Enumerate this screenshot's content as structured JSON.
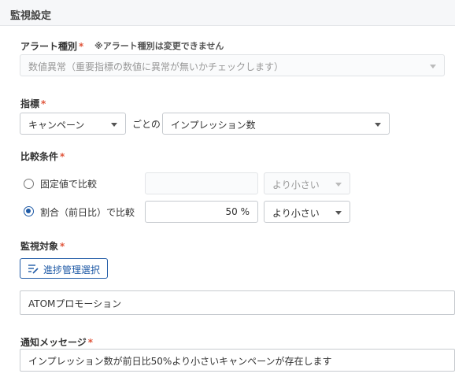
{
  "header": {
    "title": "監視設定"
  },
  "alert_type": {
    "label": "アラート種別",
    "required_mark": "*",
    "note": "※アラート種別は変更できません",
    "value": "数値異常（重要指標の数値に異常が無いかチェックします）"
  },
  "metric": {
    "label": "指標",
    "required_mark": "*",
    "group_value": "キャンペーン",
    "connector": "ごとの",
    "metric_value": "インプレッション数"
  },
  "comparison": {
    "label": "比較条件",
    "required_mark": "*",
    "options": [
      {
        "label": "固定値で比較",
        "selected": false,
        "input_value": "",
        "op_value": "より小さい"
      },
      {
        "label": "割合（前日比）で比較",
        "selected": true,
        "input_value": "50 %",
        "op_value": "より小さい"
      }
    ]
  },
  "target": {
    "label": "監視対象",
    "required_mark": "*",
    "button_label": "進捗管理選択",
    "value": "ATOMプロモーション"
  },
  "message": {
    "label": "通知メッセージ",
    "required_mark": "*",
    "value": "インプレッション数が前日比50%より小さいキャンペーンが存在します"
  },
  "colors": {
    "accent": "#1f5aa6",
    "required": "#e0553b"
  }
}
